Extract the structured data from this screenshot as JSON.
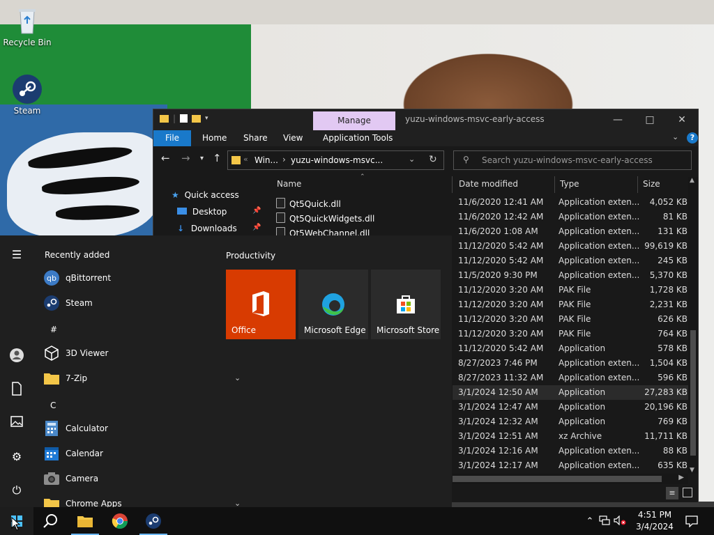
{
  "desktop": {
    "icons": [
      {
        "label": "Recycle Bin"
      },
      {
        "label": "Steam"
      }
    ]
  },
  "explorer": {
    "window_title": "yuzu-windows-msvc-early-access",
    "manage_tab": "Manage",
    "ribbon_tabs": [
      "File",
      "Home",
      "Share",
      "View",
      "Application Tools"
    ],
    "address": {
      "crumbs": [
        "Win...",
        "yuzu-windows-msvc..."
      ],
      "separator": "«"
    },
    "search_placeholder": "Search yuzu-windows-msvc-early-access",
    "columns": {
      "name": "Name",
      "date": "Date modified",
      "type": "Type",
      "size": "Size"
    },
    "nav": [
      {
        "label": "Quick access"
      },
      {
        "label": "Desktop"
      },
      {
        "label": "Downloads"
      }
    ],
    "name_rows": [
      "Qt5Quick.dll",
      "Qt5QuickWidgets.dll",
      "Qt5WebChannel.dll"
    ],
    "rows": [
      {
        "date": "11/6/2020 12:41 AM",
        "type": "Application exten...",
        "size": "4,052 KB"
      },
      {
        "date": "11/6/2020 12:42 AM",
        "type": "Application exten...",
        "size": "81 KB"
      },
      {
        "date": "11/6/2020 1:08 AM",
        "type": "Application exten...",
        "size": "131 KB"
      },
      {
        "date": "11/12/2020 5:42 AM",
        "type": "Application exten...",
        "size": "99,619 KB"
      },
      {
        "date": "11/12/2020 5:42 AM",
        "type": "Application exten...",
        "size": "245 KB"
      },
      {
        "date": "11/5/2020 9:30 PM",
        "type": "Application exten...",
        "size": "5,370 KB"
      },
      {
        "date": "11/12/2020 3:20 AM",
        "type": "PAK File",
        "size": "1,728 KB"
      },
      {
        "date": "11/12/2020 3:20 AM",
        "type": "PAK File",
        "size": "2,231 KB"
      },
      {
        "date": "11/12/2020 3:20 AM",
        "type": "PAK File",
        "size": "626 KB"
      },
      {
        "date": "11/12/2020 3:20 AM",
        "type": "PAK File",
        "size": "764 KB"
      },
      {
        "date": "11/12/2020 5:42 AM",
        "type": "Application",
        "size": "578 KB"
      },
      {
        "date": "8/27/2023 7:46 PM",
        "type": "Application exten...",
        "size": "1,504 KB"
      },
      {
        "date": "8/27/2023 11:32 AM",
        "type": "Application exten...",
        "size": "596 KB"
      },
      {
        "date": "3/1/2024 12:50 AM",
        "type": "Application",
        "size": "27,283 KB",
        "selected": true
      },
      {
        "date": "3/1/2024 12:47 AM",
        "type": "Application",
        "size": "20,196 KB"
      },
      {
        "date": "3/1/2024 12:32 AM",
        "type": "Application",
        "size": "769 KB"
      },
      {
        "date": "3/1/2024 12:51 AM",
        "type": "xz Archive",
        "size": "11,711 KB"
      },
      {
        "date": "3/1/2024 12:16 AM",
        "type": "Application exten...",
        "size": "88 KB"
      },
      {
        "date": "3/1/2024 12:17 AM",
        "type": "Application exten...",
        "size": "635 KB"
      }
    ]
  },
  "start_menu": {
    "recently_added_title": "Recently added",
    "apps": [
      {
        "label": "qBittorrent"
      },
      {
        "label": "Steam"
      },
      {
        "label": "3D Viewer"
      },
      {
        "label": "7-Zip"
      },
      {
        "label": "Calculator"
      },
      {
        "label": "Calendar"
      },
      {
        "label": "Camera"
      },
      {
        "label": "Chrome Apps"
      }
    ],
    "letters": [
      "#",
      "C"
    ],
    "group_title": "Productivity",
    "tiles": [
      {
        "label": "Office",
        "color": "#d83b01"
      },
      {
        "label": "Microsoft Edge",
        "color": "#2b2b2b"
      },
      {
        "label": "Microsoft Store",
        "color": "#2b2b2b"
      }
    ]
  },
  "taskbar": {
    "clock_time": "4:51 PM",
    "clock_date": "3/4/2024"
  },
  "colors": {
    "accent": "#1979ca",
    "manage": "#e2c9f3",
    "office": "#d83b01"
  }
}
